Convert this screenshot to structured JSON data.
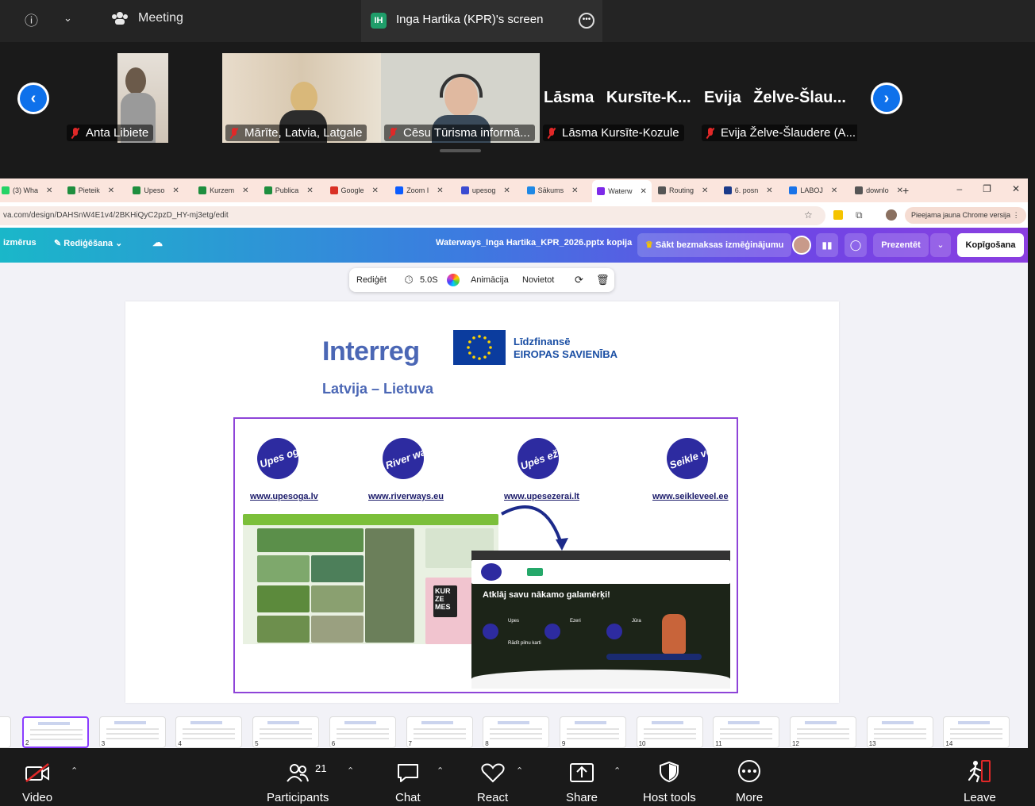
{
  "topbar": {
    "meeting_label": "Meeting",
    "share_initials": "IH",
    "share_title": "Inga Hartika (KPR)'s screen"
  },
  "gallery": {
    "participants": [
      {
        "name": "Anta Libiete",
        "muted": true
      },
      {
        "name": "Mārīte, Latvia, Latgale",
        "muted": true
      },
      {
        "name": "Cēsu Tūrisma informā...",
        "muted": true
      },
      {
        "name": "Lāsma Kursīte-Kozule",
        "display": "Lāsma Kursīte-K...",
        "muted": true
      },
      {
        "name": "Evija Želve-Šlaudere (A...",
        "display": "Evija Želve-Šlau...",
        "muted": true
      }
    ]
  },
  "browser": {
    "tabs": [
      {
        "label": "(3) Wha",
        "color": "#25d366"
      },
      {
        "label": "Pieteik",
        "color": "#1e8e3e"
      },
      {
        "label": "Upeso",
        "color": "#1e8e3e"
      },
      {
        "label": "Kurzem",
        "color": "#1e8e3e"
      },
      {
        "label": "Publica",
        "color": "#1e8e3e"
      },
      {
        "label": "Google",
        "color": "#d93025"
      },
      {
        "label": "Zoom I",
        "color": "#0b5cff"
      },
      {
        "label": "upesog",
        "color": "#3b4bd1"
      },
      {
        "label": "Sākums",
        "color": "#1e88e5"
      },
      {
        "label": "Waterw",
        "color": "#7d2ae8",
        "active": true
      },
      {
        "label": "Routing",
        "color": "#555555"
      },
      {
        "label": "6. posn",
        "color": "#1a3a8a"
      },
      {
        "label": "LABOJ",
        "color": "#1a73e8"
      },
      {
        "label": "downlo",
        "color": "#555555"
      }
    ],
    "url": "va.com/design/DAHSnW4E1v4/2BKHiQyC2pzD_HY-mj3etg/edit",
    "new_chrome": "Pieejama jauna Chrome versija"
  },
  "canva": {
    "resize": "izmērus",
    "editing": "Rediģēšana",
    "doc_title": "Waterways_Inga Hartika_KPR_2026.pptx kopija",
    "trial": "Sākt bezmaksas izmēģinājumu",
    "present": "Prezentēt",
    "share": "Kopīgošana",
    "toolbar": {
      "edit": "Rediģēt",
      "duration": "5.0S",
      "animation": "Animācija",
      "position": "Novietot"
    }
  },
  "slide": {
    "interreg": "Interreg",
    "cofunded_line1": "Līdzfinansē",
    "cofunded_line2": "EIROPAS SAVIENĪBA",
    "program": "Latvija – Lietuva",
    "logos": [
      {
        "text": "Upes oga",
        "url": "www.upesoga.lv"
      },
      {
        "text": "River ways",
        "url": "www.riverways.eu"
      },
      {
        "text": "Upės ežerai",
        "url": "www.upesezerai.lt"
      },
      {
        "text": "Seikle veel",
        "url": "www.seikleveel.ee"
      }
    ],
    "screenshot_headline": "Atklāj savu nākamo galamērķi!",
    "screenshot_items": [
      "Upes",
      "Ezeri",
      "Jūra",
      "Rādīt pilnu karti"
    ]
  },
  "thumbnails": [
    "2",
    "3",
    "4",
    "5",
    "6",
    "7",
    "8",
    "9",
    "10",
    "11",
    "12",
    "13",
    "14"
  ],
  "bottombar": {
    "video": "Video",
    "participants": "Participants",
    "participants_count": "21",
    "chat": "Chat",
    "react": "React",
    "share": "Share",
    "host_tools": "Host tools",
    "more": "More",
    "leave": "Leave"
  }
}
